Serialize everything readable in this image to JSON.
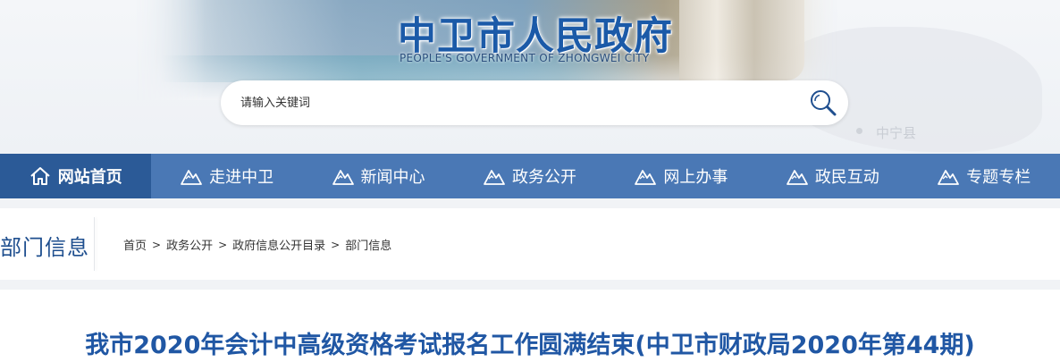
{
  "header": {
    "title": "中卫市人民政府",
    "subtitle": "PEOPLE'S GOVERNMENT OF ZHONGWEI CITY",
    "map_label": "中宁县"
  },
  "search": {
    "placeholder": "请输入关键词",
    "icon": "search-icon"
  },
  "nav": {
    "items": [
      {
        "label": "网站首页",
        "icon": "home-icon"
      },
      {
        "label": "走进中卫",
        "icon": "mountain-icon"
      },
      {
        "label": "新闻中心",
        "icon": "mountain-icon"
      },
      {
        "label": "政务公开",
        "icon": "mountain-icon"
      },
      {
        "label": "网上办事",
        "icon": "mountain-icon"
      },
      {
        "label": "政民互动",
        "icon": "mountain-icon"
      },
      {
        "label": "专题专栏",
        "icon": "mountain-icon"
      }
    ]
  },
  "section": {
    "title": "部门信息"
  },
  "breadcrumb": {
    "items": [
      "首页",
      "政务公开",
      "政府信息公开目录",
      "部门信息"
    ],
    "separator": ">"
  },
  "article": {
    "title": "我市2020年会计中高级资格考试报名工作圆满结束(中卫市财政局2020年第44期)"
  },
  "colors": {
    "nav_bg": "#4a78b5",
    "nav_active": "#2b5a97",
    "title_blue": "#1b5aa8"
  }
}
